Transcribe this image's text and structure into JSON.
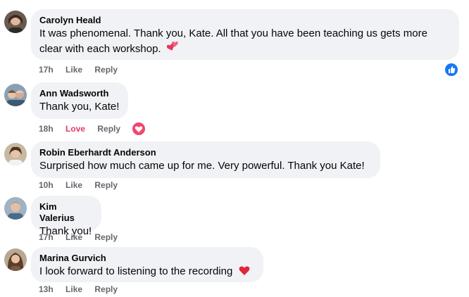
{
  "comments": [
    {
      "author": "Carolyn Heald",
      "text_line1": "It was phenomenal. Thank you, Kate. All that you have been teaching us gets more",
      "text_line2": "clear with each workshop.",
      "emoji": "two-hearts-icon",
      "time": "17h",
      "like_label": "Like",
      "reply_label": "Reply",
      "reaction": "like-reaction-icon"
    },
    {
      "author": "Ann Wadsworth",
      "text": "Thank you, Kate!",
      "time": "18h",
      "like_label": "Love",
      "reply_label": "Reply",
      "reaction": "love-reaction-icon"
    },
    {
      "author": "Robin Eberhardt Anderson",
      "text": "Surprised how much came up for me. Very powerful. Thank you Kate!",
      "time": "10h",
      "like_label": "Like",
      "reply_label": "Reply"
    },
    {
      "author": "Kim Valerius",
      "text": "Thank you!",
      "time": "17h",
      "like_label": "Like",
      "reply_label": "Reply"
    },
    {
      "author": "Marina Gurvich",
      "text": "I look forward to listening to the recording",
      "emoji": "red-heart-icon",
      "time": "13h",
      "like_label": "Like",
      "reply_label": "Reply"
    }
  ],
  "colors": {
    "bubble": "#f0f2f5",
    "meta": "#65676b",
    "love": "#e7386a",
    "like_blue": "#1877f2"
  }
}
